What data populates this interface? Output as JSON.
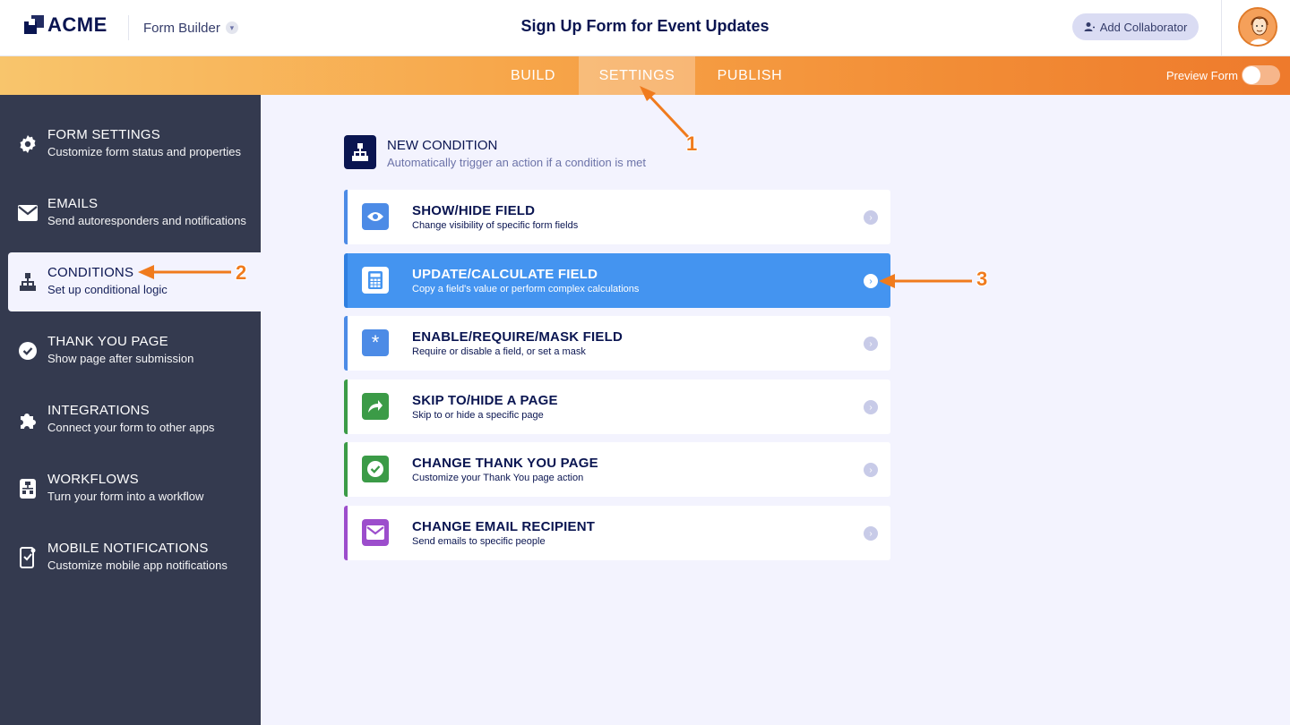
{
  "header": {
    "brand": "ACME",
    "app_switcher": "Form Builder",
    "form_title": "Sign Up Form for Event Updates",
    "add_collaborator": "Add Collaborator"
  },
  "nav": {
    "tabs": [
      {
        "label": "BUILD",
        "active": false
      },
      {
        "label": "SETTINGS",
        "active": true
      },
      {
        "label": "PUBLISH",
        "active": false
      }
    ],
    "preview_label": "Preview Form",
    "preview_on": false
  },
  "sidebar": {
    "items": [
      {
        "title": "FORM SETTINGS",
        "desc": "Customize form status and properties",
        "icon": "gear-icon"
      },
      {
        "title": "EMAILS",
        "desc": "Send autoresponders and notifications",
        "icon": "envelope-icon"
      },
      {
        "title": "CONDITIONS",
        "desc": "Set up conditional logic",
        "icon": "hierarchy-icon",
        "active": true
      },
      {
        "title": "THANK YOU PAGE",
        "desc": "Show page after submission",
        "icon": "check-circle-icon"
      },
      {
        "title": "INTEGRATIONS",
        "desc": "Connect your form to other apps",
        "icon": "puzzle-icon"
      },
      {
        "title": "WORKFLOWS",
        "desc": "Turn your form into a workflow",
        "icon": "workflow-icon"
      },
      {
        "title": "MOBILE NOTIFICATIONS",
        "desc": "Customize mobile app notifications",
        "icon": "mobile-icon"
      }
    ]
  },
  "main": {
    "new_condition": {
      "title": "NEW CONDITION",
      "desc": "Automatically trigger an action if a condition is met"
    },
    "cards": [
      {
        "title": "SHOW/HIDE FIELD",
        "desc": "Change visibility of specific form fields",
        "icon": "eye-icon",
        "color": "#4c8be6"
      },
      {
        "title": "UPDATE/CALCULATE FIELD",
        "desc": "Copy a field's value or perform complex calculations",
        "icon": "calculator-icon",
        "color": "#4c8be6",
        "selected": true
      },
      {
        "title": "ENABLE/REQUIRE/MASK FIELD",
        "desc": "Require or disable a field, or set a mask",
        "icon": "asterisk-icon",
        "color": "#4c8be6"
      },
      {
        "title": "SKIP TO/HIDE A PAGE",
        "desc": "Skip to or hide a specific page",
        "icon": "share-arrow-icon",
        "color": "#3b9b47"
      },
      {
        "title": "CHANGE THANK YOU PAGE",
        "desc": "Customize your Thank You page action",
        "icon": "check-badge-icon",
        "color": "#3b9b47"
      },
      {
        "title": "CHANGE EMAIL RECIPIENT",
        "desc": "Send emails to specific people",
        "icon": "envelope-icon",
        "color": "#9c4dcc"
      }
    ]
  },
  "annotations": {
    "n1": "1",
    "n2": "2",
    "n3": "3",
    "color": "#f07b1d"
  }
}
